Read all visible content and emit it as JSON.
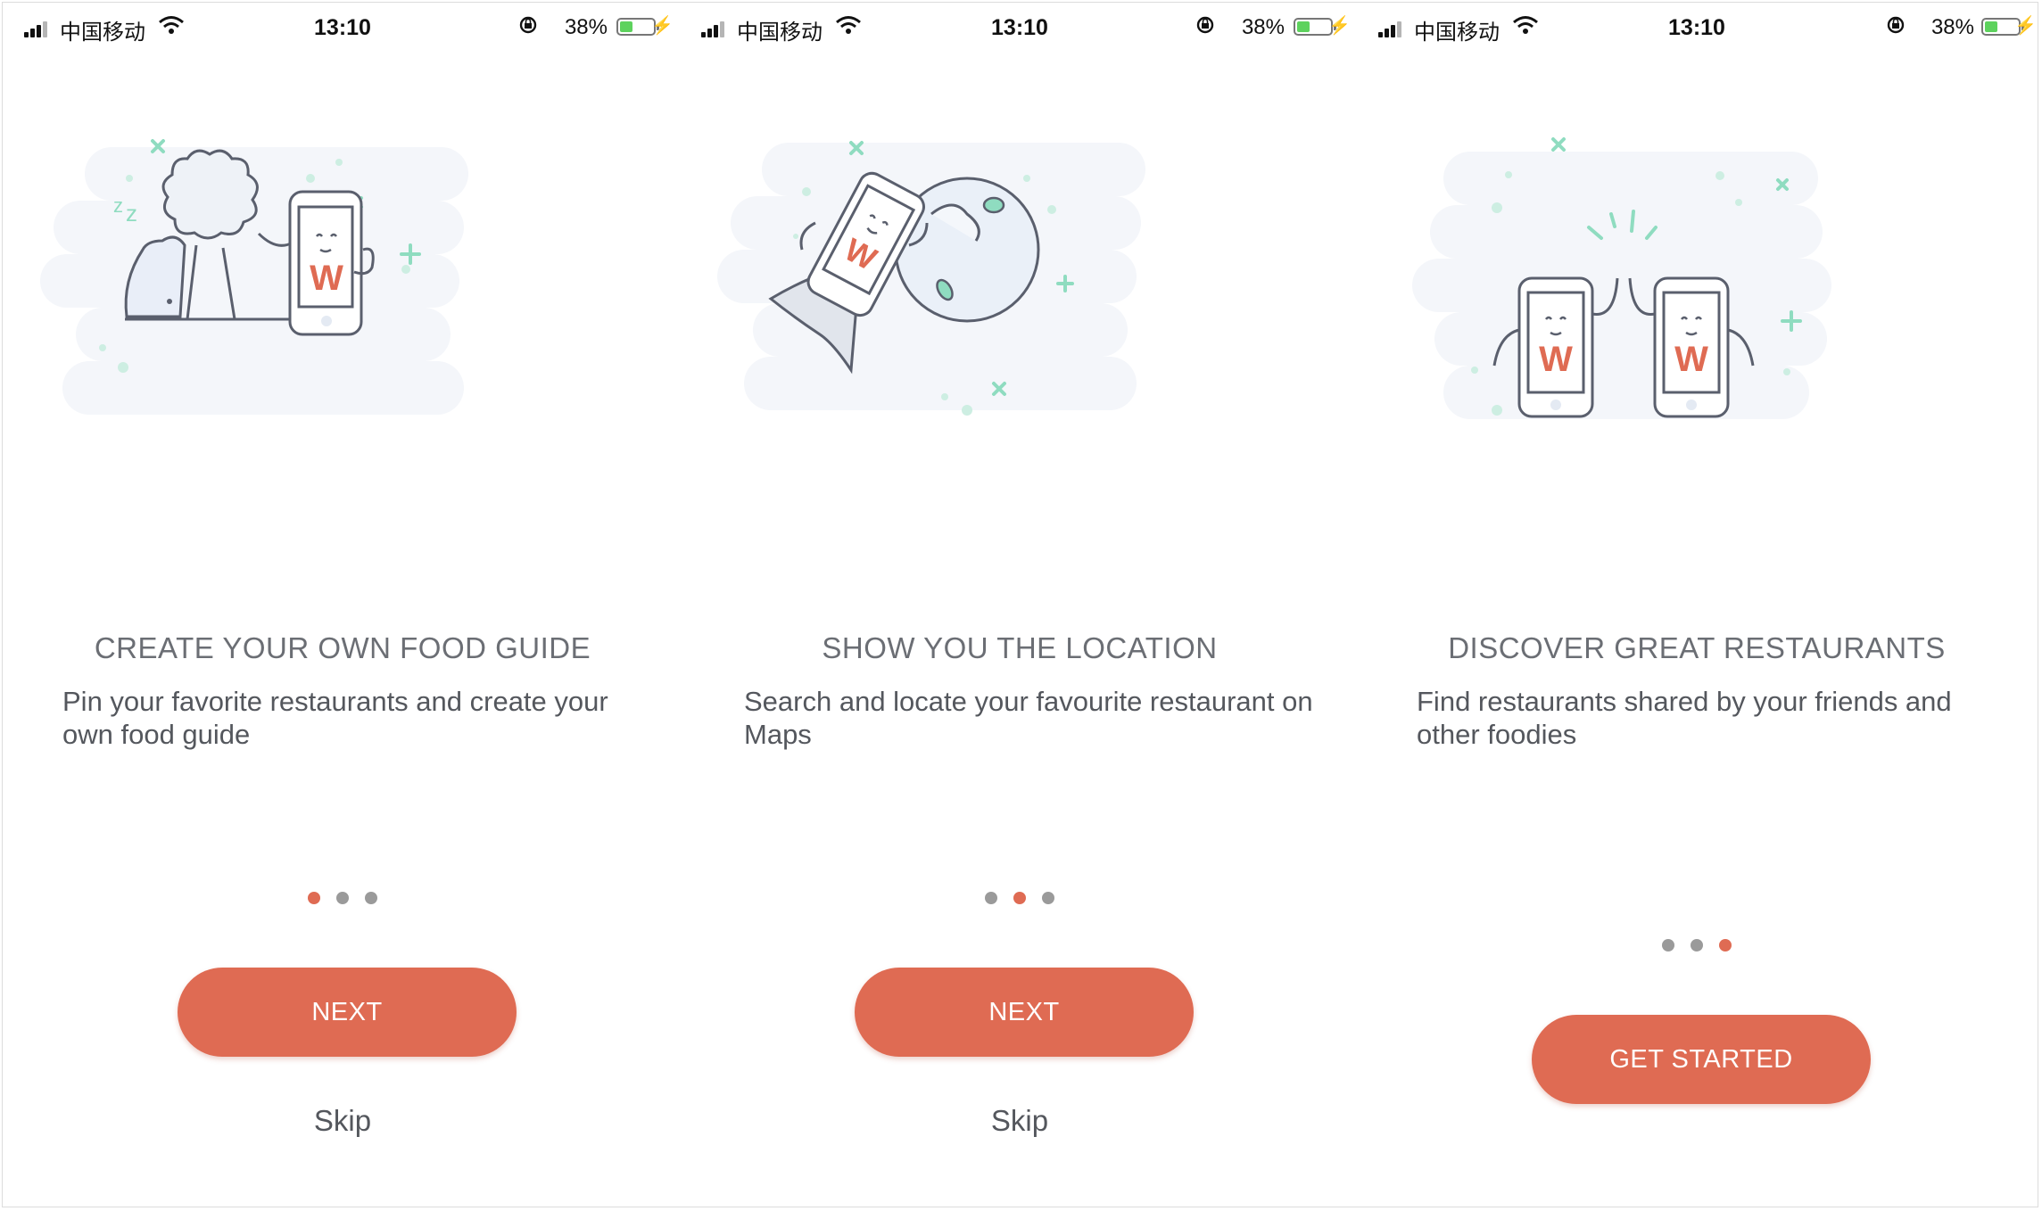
{
  "status_bar": {
    "carrier": "中国移动",
    "time": "13:10",
    "battery": "38%"
  },
  "screens": [
    {
      "title": "CREATE YOUR OWN FOOD GUIDE",
      "description": "Pin your favorite restaurants and create your own food guide",
      "button": "NEXT",
      "skip": "Skip",
      "page": "1 of 3"
    },
    {
      "title": "SHOW YOU THE LOCATION",
      "description": "Search and locate your favourite restaurant on Maps",
      "button": "NEXT",
      "skip": "Skip",
      "page": "2 of 3"
    },
    {
      "title": "DISCOVER GREAT RESTAURANTS",
      "description": "Find restaurants shared by your friends and other foodies",
      "button": "GET STARTED",
      "page": "3 of 3"
    }
  ],
  "illustration_logo": "W",
  "colors": {
    "accent": "#df6b53",
    "text": "#54575d",
    "title": "#6b6e74",
    "dot_inactive": "#9a9a9a",
    "sparkle": "#8fdcc0"
  },
  "icons": [
    "signal-icon",
    "wifi-icon",
    "orientation-lock-icon",
    "battery-icon",
    "charging-icon"
  ]
}
